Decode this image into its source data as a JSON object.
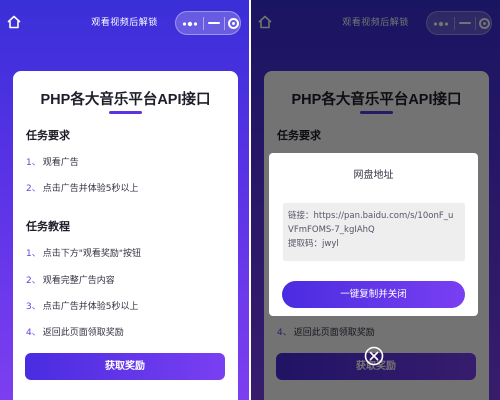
{
  "topbar": {
    "title": "观看视频后解锁"
  },
  "card": {
    "title": "PHP各大音乐平台API接口",
    "requirements_heading": "任务要求",
    "requirements": [
      {
        "num": "1、",
        "text": "观看广告"
      },
      {
        "num": "2、",
        "text": "点击广告并体验5秒以上"
      }
    ],
    "tutorial_heading": "任务教程",
    "tutorial": [
      {
        "num": "1、",
        "text": "点击下方\"观看奖励\"按钮"
      },
      {
        "num": "2、",
        "text": "观看完整广告内容"
      },
      {
        "num": "3、",
        "text": "点击广告并体验5秒以上"
      },
      {
        "num": "4、",
        "text": "返回此页面领取奖励"
      }
    ],
    "cta_label": "获取奖励"
  },
  "modal": {
    "title": "网盘地址",
    "link_line1": "链接：https://pan.baidu.com/s/10onF_u",
    "link_line2": "VFmFOMS-7_kgIAhQ",
    "code_line": "提取码：jwyl",
    "copy_button": "一键复制并关闭"
  },
  "colors": {
    "accent": "#5b35e3",
    "gradient_start": "#4a2ce0",
    "gradient_end": "#7a3ff2"
  },
  "icons": [
    "home-icon",
    "more-dots-icon",
    "minimize-icon",
    "close-target-icon",
    "close-circle-icon"
  ]
}
